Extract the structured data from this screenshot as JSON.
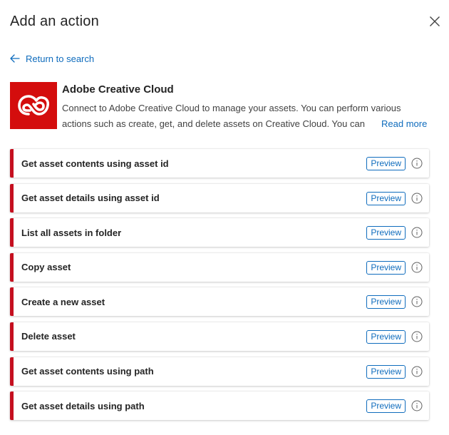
{
  "header": {
    "title": "Add an action"
  },
  "nav": {
    "back_label": "Return to search"
  },
  "connector": {
    "name": "Adobe Creative Cloud",
    "description_line1": "Connect to Adobe Creative Cloud to manage your assets. You can perform various",
    "description_line2": "actions such as create, get, and delete assets on Creative Cloud. You can",
    "read_more": "Read more",
    "logo_icon": "adobe-creative-cloud-logo",
    "brand_color": "#d40d0d"
  },
  "actions": [
    {
      "label": "Get asset contents using asset id",
      "badge": "Preview"
    },
    {
      "label": "Get asset details using asset id",
      "badge": "Preview"
    },
    {
      "label": "List all assets in folder",
      "badge": "Preview"
    },
    {
      "label": "Copy asset",
      "badge": "Preview"
    },
    {
      "label": "Create a new asset",
      "badge": "Preview"
    },
    {
      "label": "Delete asset",
      "badge": "Preview"
    },
    {
      "label": "Get asset contents using path",
      "badge": "Preview"
    },
    {
      "label": "Get asset details using path",
      "badge": "Preview"
    }
  ],
  "colors": {
    "accent": "#0f6cbd",
    "action_stripe": "#c50f1f"
  }
}
